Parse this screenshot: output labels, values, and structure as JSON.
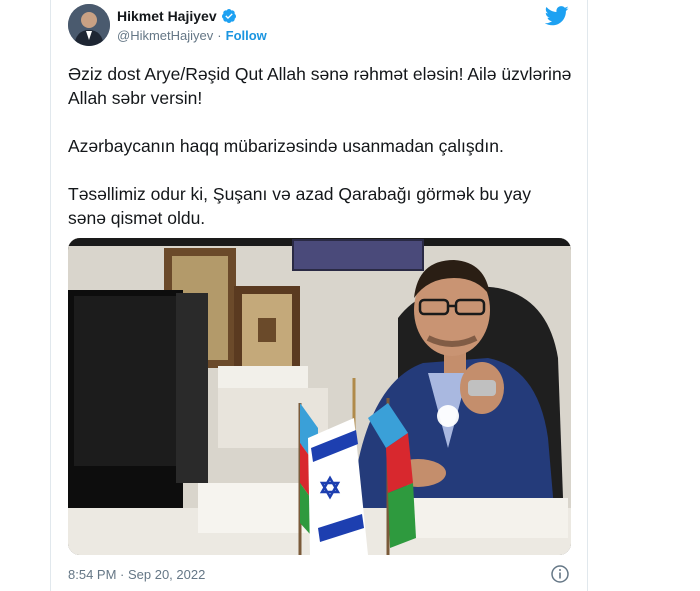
{
  "author": {
    "name": "Hikmet Hajiyev",
    "handle": "@HikmetHajiyev",
    "separator": "·",
    "follow_label": "Follow"
  },
  "tweet": {
    "paragraphs": [
      "Əziz dost Arye/Rəşid Qut Allah sənə rəhmət eləsin! Ailə üzvlərinə Allah səbr versin!",
      "Azərbaycanın haqq mübarizəsində usanmadan çalışdın.",
      "Təsəllimiz odur ki, Şuşanı və azad Qarabağı görmək bu yay sənə qismət oldu."
    ]
  },
  "footer": {
    "timestamp": "8:54 PM · Sep 20, 2022"
  },
  "colors": {
    "accent": "#1da1f2",
    "follow": "#1b95e0",
    "text": "#14171a",
    "muted": "#657786"
  },
  "icons": {
    "bird": "twitter-bird-icon",
    "verified": "verified-badge-icon",
    "info": "info-icon"
  }
}
